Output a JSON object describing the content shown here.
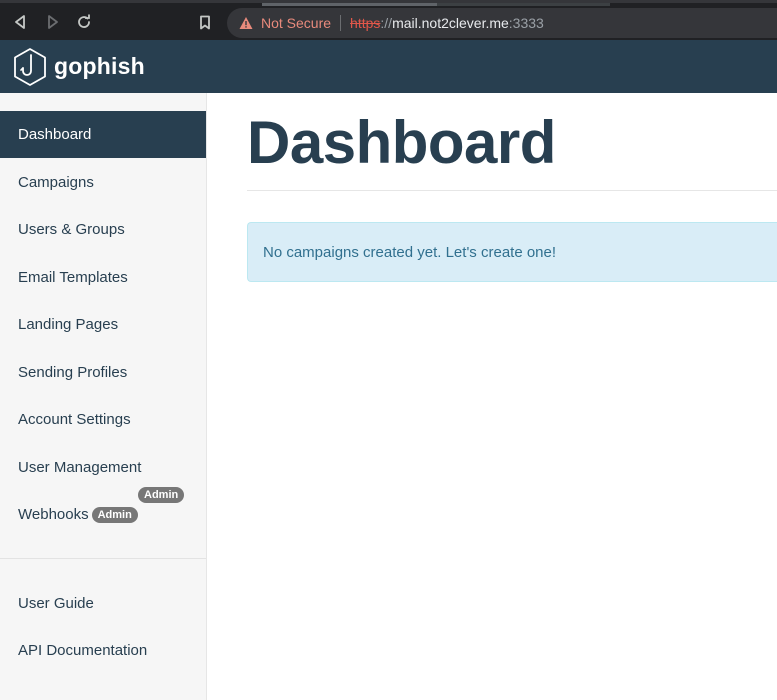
{
  "browser": {
    "security_label": "Not Secure",
    "url_scheme": "https",
    "url_separator": "://",
    "url_host": "mail.not2clever.me",
    "url_port": ":3333"
  },
  "app": {
    "logo_text": "gophish"
  },
  "sidebar": {
    "items": [
      {
        "label": "Dashboard",
        "active": true
      },
      {
        "label": "Campaigns"
      },
      {
        "label": "Users & Groups"
      },
      {
        "label": "Email Templates"
      },
      {
        "label": "Landing Pages"
      },
      {
        "label": "Sending Profiles"
      },
      {
        "label": "Account Settings"
      },
      {
        "label": "User Management"
      },
      {
        "label": "Webhooks"
      }
    ],
    "admin_badge_1": "Admin",
    "admin_badge_2": "Admin",
    "footer_items": [
      {
        "label": "User Guide"
      },
      {
        "label": "API Documentation"
      }
    ]
  },
  "main": {
    "title": "Dashboard",
    "alert_text": "No campaigns created yet. Let's create one!"
  },
  "colors": {
    "header_bg": "#283f50",
    "alert_bg": "#d9edf7",
    "alert_text": "#31708f",
    "badge_bg": "#777777"
  }
}
